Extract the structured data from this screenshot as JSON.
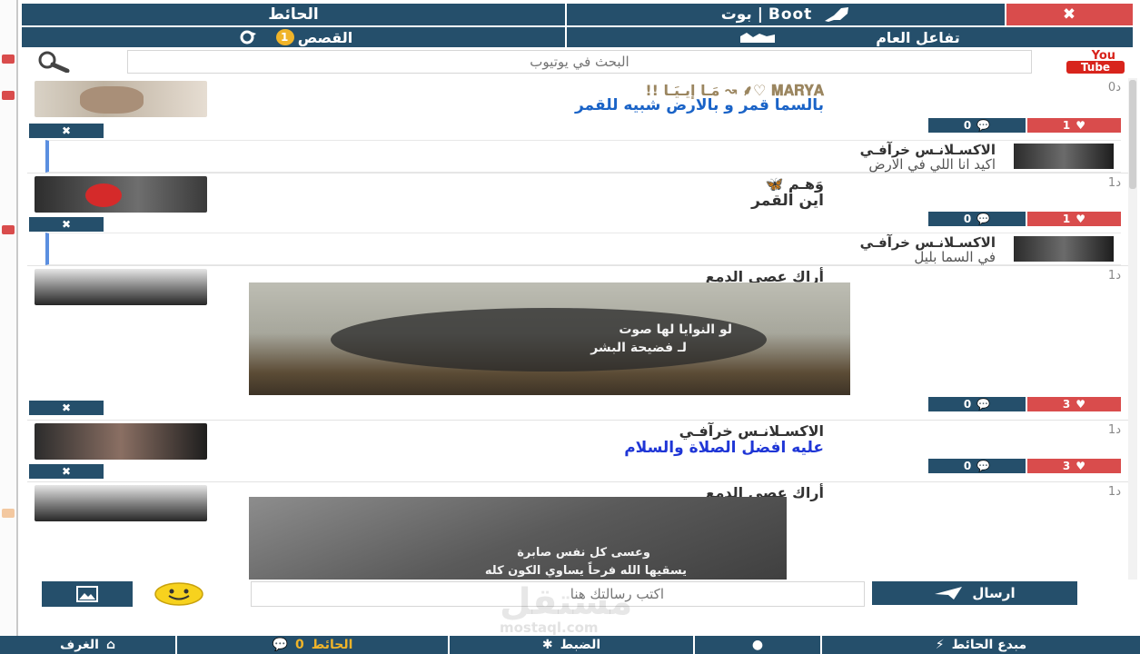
{
  "tabs": {
    "wall": "الحائط",
    "bot": "بوت | Boot",
    "close": "✖",
    "stories": "القصص",
    "stories_badge": "1",
    "interaction": "تفاعل العام"
  },
  "search": {
    "placeholder": "البحث في يوتيوب",
    "youtube_you": "You",
    "youtube_tube": "Tube"
  },
  "posts": [
    {
      "username": "𝐌𝐀𝐑𝐘𝐀 ♡⸙ ↝ مَـا إيـيَـا !!",
      "text": "بالسما قمر و بالارض شبيه للقمر",
      "age": "0د",
      "likes": "1",
      "comments": "0",
      "reply": {
        "username": "الاكسـلانـس خرآفـي",
        "text": "اكيد انا اللي في الارض"
      }
    },
    {
      "username": "وَهـم 🦋",
      "text": "اين القمر",
      "age": "1د",
      "likes": "1",
      "comments": "0",
      "reply": {
        "username": "الاكسـلانـس خرآفـي",
        "text": "في السما بليل"
      }
    },
    {
      "username": "أراك عصي الدمع",
      "age": "1د",
      "likes": "3",
      "comments": "0",
      "media_caption_1": "لو النوايا لها صوت",
      "media_caption_2": "لـ فضيحة البشر"
    },
    {
      "username": "الاكسـلانـس خرآفـي",
      "text": "عليه افضل الصلاة والسلام",
      "age": "1د",
      "likes": "3",
      "comments": "0"
    },
    {
      "username": "أراك عصي الدمع",
      "age": "1د",
      "media_caption_1": "وعسى كل نفس صابرة",
      "media_caption_2": "يسقيها الله فرحاً يساوي الكون كله"
    }
  ],
  "composer": {
    "placeholder": "اكتب رسالتك هنا",
    "send": "ارسال"
  },
  "watermark": {
    "main": "مستقل",
    "sub": "mostaql.com"
  },
  "bottom_nav": {
    "rooms": "الغرف",
    "wall": "الحائط",
    "wall_count": "0",
    "settings": "الضبط",
    "creator": "مبدع الحائط"
  },
  "colors": {
    "primary": "#254f6b",
    "like": "#d94c4c",
    "link_blue": "#1a63c7",
    "accent": "#f0b429"
  }
}
